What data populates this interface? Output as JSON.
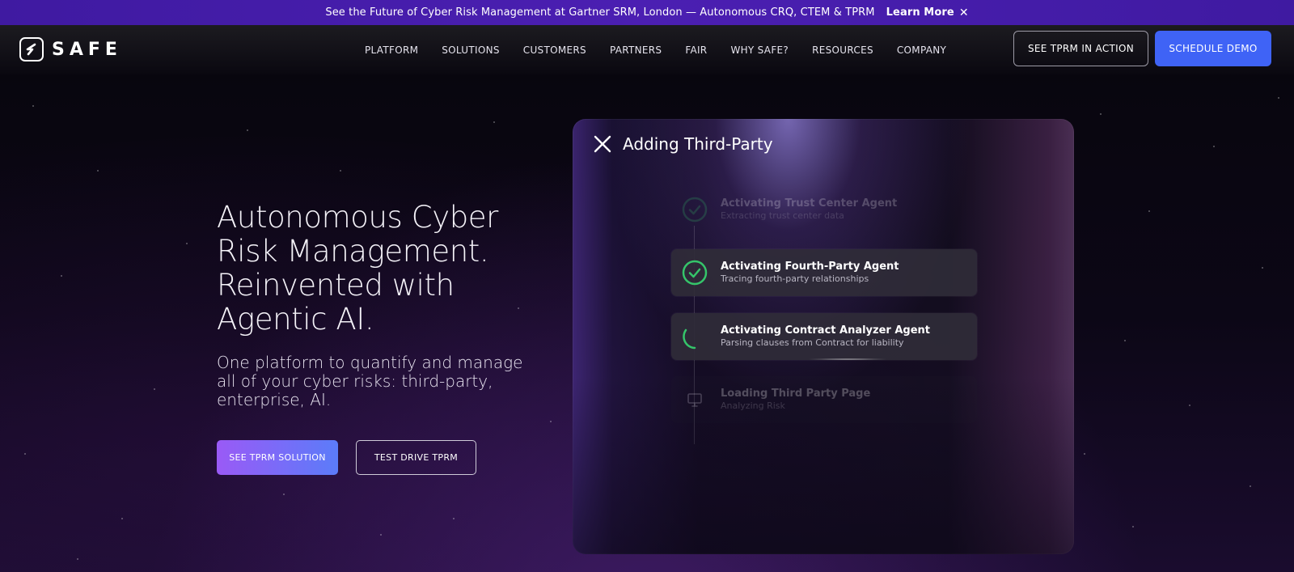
{
  "banner": {
    "text": "See the Future of Cyber Risk Management at Gartner SRM, London — Autonomous CRQ, CTEM & TPRM",
    "link": "Learn More",
    "close": "✕"
  },
  "header": {
    "logo_text": "SAFE",
    "nav": [
      {
        "label": "PLATFORM"
      },
      {
        "label": "SOLUTIONS"
      },
      {
        "label": "CUSTOMERS"
      },
      {
        "label": "PARTNERS"
      },
      {
        "label": "FAIR"
      },
      {
        "label": "WHY SAFE?"
      },
      {
        "label": "RESOURCES"
      },
      {
        "label": "COMPANY"
      }
    ],
    "cta_outline": "SEE TPRM IN ACTION",
    "cta_primary": "SCHEDULE DEMO"
  },
  "hero": {
    "title": "Autonomous Cyber Risk Management. Reinvented with Agentic AI.",
    "subtitle": "One platform to quantify and manage all of your cyber risks: third-party, enterprise, AI.",
    "primary_button": "SEE TPRM SOLUTION",
    "secondary_button": "TEST DRIVE TPRM"
  },
  "panel": {
    "title": "Adding Third-Party",
    "steps": [
      {
        "title": "Activating Trust Center Agent",
        "subtitle": "Extracting trust center data",
        "state": "done-faded"
      },
      {
        "title": "Activating Fourth-Party Agent",
        "subtitle": "Tracing fourth-party relationships",
        "state": "done"
      },
      {
        "title": "Activating Contract Analyzer Agent",
        "subtitle": "Parsing clauses from Contract for liability",
        "state": "loading"
      },
      {
        "title": "Loading Third Party Page",
        "subtitle": "Analyzing Risk",
        "state": "pending"
      }
    ]
  },
  "colors": {
    "banner": "#4b1fb2",
    "demo_button": "#3f63f6",
    "check_green": "#35c56a",
    "primary_gradient_start": "#9a5af6",
    "primary_gradient_end": "#5b7cf9"
  },
  "icons": {
    "logo": "safe-logo-icon",
    "close_banner": "close-icon",
    "panel_close": "close-icon",
    "done": "check-circle-icon",
    "loading": "spinner-icon",
    "pending": "monitor-icon"
  }
}
